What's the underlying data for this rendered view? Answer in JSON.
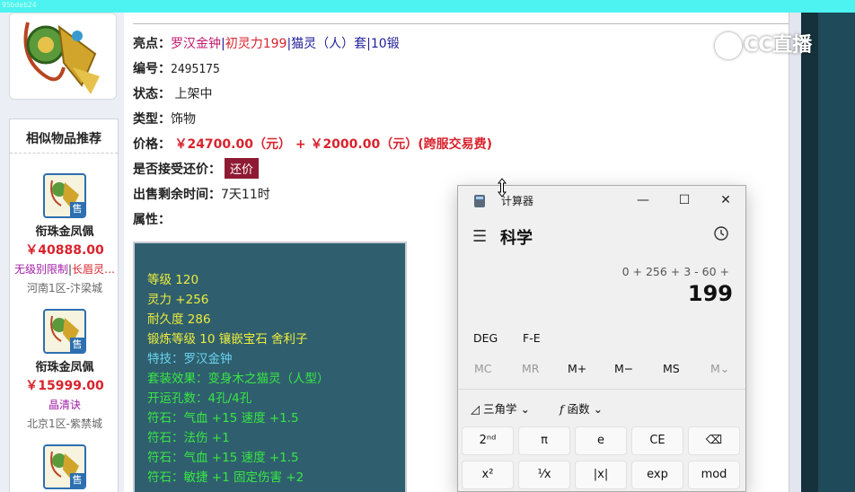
{
  "window": {
    "caption": "95bdeb24"
  },
  "watermark": {
    "text": "CC直播"
  },
  "similar": {
    "title": "相似物品推荐",
    "items": [
      {
        "name": "衔珠金凤佩",
        "price": "￥40888.00",
        "tag1": "无级别限制",
        "tag_sep": "|",
        "tag2": "长眉灵…",
        "server": "河南1区-汴梁城"
      },
      {
        "name": "衔珠金凤佩",
        "price": "￥15999.00",
        "tag1": "晶清诀",
        "server": "北京1区-紫禁城"
      }
    ],
    "sell_badge": "售"
  },
  "details": {
    "highlight_label": "亮点：",
    "highlight_parts": [
      "罗汉金钟",
      "|",
      "初灵力199",
      "|",
      "猫灵（人）套",
      "|",
      "10锻"
    ],
    "id_label": "编号：",
    "id_value": "2495175",
    "status_label": "状态：",
    "status_value": "上架中",
    "type_label": "类型：",
    "type_value": "饰物",
    "price_label": "价格：",
    "price_value": "￥24700.00（元） + ￥2000.00（元）(跨服交易费)",
    "haggle_label": "是否接受还价：",
    "haggle_button": "还价",
    "time_label": "出售剩余时间：",
    "time_value": "7天11时",
    "attr_label": "属性："
  },
  "attributes": [
    {
      "text": "等级 120",
      "color": "#ecec3c"
    },
    {
      "text": "灵力 +256",
      "color": "#ecec3c"
    },
    {
      "text": "耐久度 286",
      "color": "#ecec3c"
    },
    {
      "text": "锻炼等级 10 镶嵌宝石 舍利子",
      "color": "#ecec3c"
    },
    {
      "text": "特技：罗汉金钟",
      "color": "#6ad2ee"
    },
    {
      "text": "套装效果：变身木之猫灵（人型）",
      "color": "#38e644"
    },
    {
      "text": "开运孔数：4孔/4孔",
      "color": "#38e644"
    },
    {
      "text": "符石：气血 +15 速度 +1.5",
      "color": "#38e644"
    },
    {
      "text": "符石：法伤 +1",
      "color": "#38e644"
    },
    {
      "text": "符石：气血 +15 速度 +1.5",
      "color": "#38e644"
    },
    {
      "text": "符石：敏捷 +1 固定伤害 +2",
      "color": "#38e644"
    }
  ],
  "calculator": {
    "title": "计算器",
    "minimize": "—",
    "maximize": "☐",
    "close": "✕",
    "menu_icon": "☰",
    "mode": "科学",
    "history_icon": "history-icon",
    "expression": "0 + 256 + 3 - 60 +",
    "result": "199",
    "deg": "DEG",
    "fe": "F-E",
    "memory": [
      "MC",
      "MR",
      "M+",
      "M−",
      "MS",
      "M⌄"
    ],
    "trig_label": "三角学",
    "func_label": "函数",
    "keys_row1": [
      "2ⁿᵈ",
      "π",
      "e",
      "CE",
      "⌫"
    ],
    "keys_row2": [
      "x²",
      "¹⁄x",
      "|x|",
      "exp",
      "mod"
    ]
  }
}
